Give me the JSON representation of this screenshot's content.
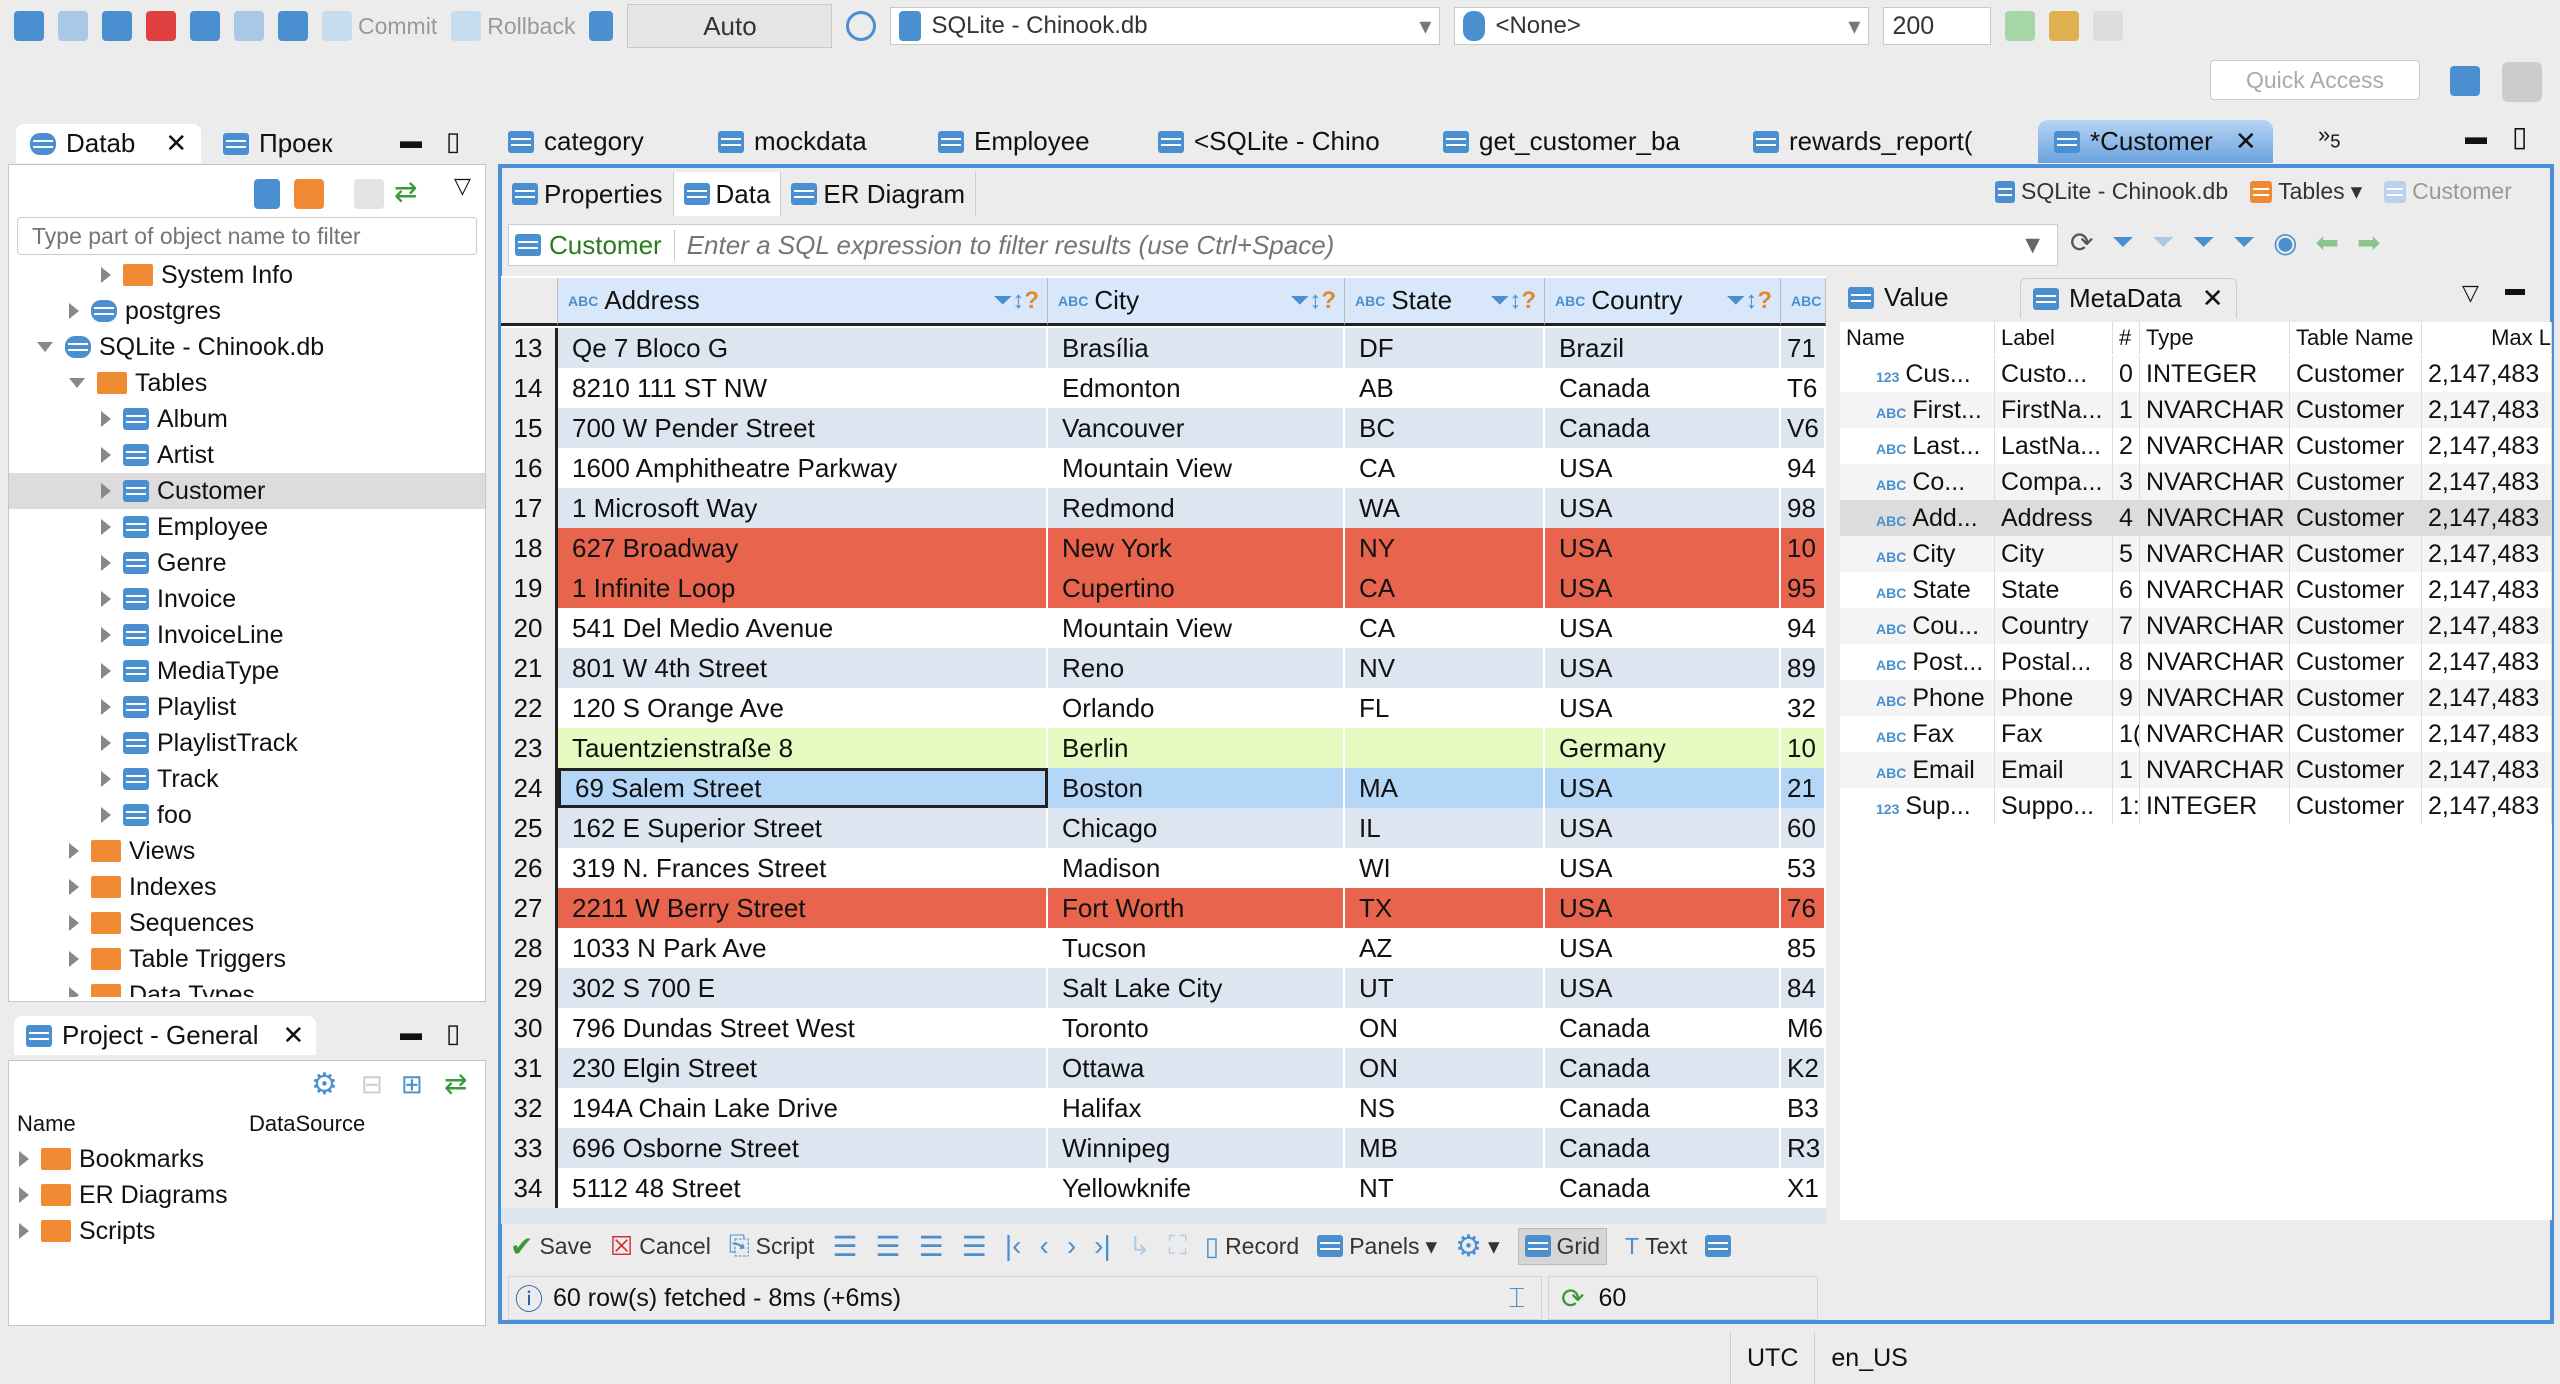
{
  "toolbar": {
    "commit": "Commit",
    "rollback": "Rollback",
    "mode": "Auto",
    "connection": "SQLite - Chinook.db",
    "schema": "<None>",
    "limit": "200",
    "quick_access": "Quick Access"
  },
  "left_tabs": {
    "database": "Datab",
    "project": "Проек"
  },
  "filter_placeholder": "Type part of object name to filter",
  "tree": [
    {
      "label": "System Info",
      "level": 2,
      "kind": "folder",
      "open": false
    },
    {
      "label": "postgres",
      "level": 1,
      "kind": "db",
      "open": false
    },
    {
      "label": "SQLite - Chinook.db",
      "level": 0,
      "kind": "db",
      "open": true
    },
    {
      "label": "Tables",
      "level": 1,
      "kind": "folder",
      "open": true
    },
    {
      "label": "Album",
      "level": 2,
      "kind": "table",
      "open": false
    },
    {
      "label": "Artist",
      "level": 2,
      "kind": "table",
      "open": false
    },
    {
      "label": "Customer",
      "level": 2,
      "kind": "table",
      "open": false,
      "selected": true
    },
    {
      "label": "Employee",
      "level": 2,
      "kind": "table",
      "open": false
    },
    {
      "label": "Genre",
      "level": 2,
      "kind": "table",
      "open": false
    },
    {
      "label": "Invoice",
      "level": 2,
      "kind": "table",
      "open": false
    },
    {
      "label": "InvoiceLine",
      "level": 2,
      "kind": "table",
      "open": false
    },
    {
      "label": "MediaType",
      "level": 2,
      "kind": "table",
      "open": false
    },
    {
      "label": "Playlist",
      "level": 2,
      "kind": "table",
      "open": false
    },
    {
      "label": "PlaylistTrack",
      "level": 2,
      "kind": "table",
      "open": false
    },
    {
      "label": "Track",
      "level": 2,
      "kind": "table",
      "open": false
    },
    {
      "label": "foo",
      "level": 2,
      "kind": "table",
      "open": false
    },
    {
      "label": "Views",
      "level": 1,
      "kind": "folder",
      "open": false
    },
    {
      "label": "Indexes",
      "level": 1,
      "kind": "folder",
      "open": false
    },
    {
      "label": "Sequences",
      "level": 1,
      "kind": "folder",
      "open": false
    },
    {
      "label": "Table Triggers",
      "level": 1,
      "kind": "folder",
      "open": false
    },
    {
      "label": "Data Types",
      "level": 1,
      "kind": "folder",
      "open": false
    }
  ],
  "project": {
    "title": "Project - General",
    "col_name": "Name",
    "col_datasource": "DataSource",
    "items": [
      "Bookmarks",
      "ER Diagrams",
      "Scripts"
    ]
  },
  "editor_tabs": [
    "category",
    "mockdata",
    "Employee",
    "<SQLite - Chino",
    "get_customer_ba",
    "rewards_report(",
    "*Customer"
  ],
  "overflow_count": "5",
  "sub_tabs": [
    "Properties",
    "Data",
    "ER Diagram"
  ],
  "breadcrumb": {
    "connection": "SQLite - Chinook.db",
    "folder": "Tables",
    "table": "Customer"
  },
  "filter": {
    "entity": "Customer",
    "placeholder": "Enter a SQL expression to filter results (use Ctrl+Space)"
  },
  "grid": {
    "columns": [
      "Address",
      "City",
      "State",
      "Country"
    ],
    "rows": [
      {
        "n": "13",
        "address": "Qe 7 Bloco G",
        "city": "Brasília",
        "state": "DF",
        "country": "Brazil",
        "postal": "71"
      },
      {
        "n": "14",
        "address": "8210 111 ST NW",
        "city": "Edmonton",
        "state": "AB",
        "country": "Canada",
        "postal": "T6"
      },
      {
        "n": "15",
        "address": "700 W Pender Street",
        "city": "Vancouver",
        "state": "BC",
        "country": "Canada",
        "postal": "V6"
      },
      {
        "n": "16",
        "address": "1600 Amphitheatre Parkway",
        "city": "Mountain View",
        "state": "CA",
        "country": "USA",
        "postal": "94"
      },
      {
        "n": "17",
        "address": "1 Microsoft Way",
        "city": "Redmond",
        "state": "WA",
        "country": "USA",
        "postal": "98"
      },
      {
        "n": "18",
        "address": "627 Broadway",
        "city": "New York",
        "state": "NY",
        "country": "USA",
        "postal": "10",
        "highlight": "red"
      },
      {
        "n": "19",
        "address": "1 Infinite Loop",
        "city": "Cupertino",
        "state": "CA",
        "country": "USA",
        "postal": "95",
        "highlight": "red"
      },
      {
        "n": "20",
        "address": "541 Del Medio Avenue",
        "city": "Mountain View",
        "state": "CA",
        "country": "USA",
        "postal": "94"
      },
      {
        "n": "21",
        "address": "801 W 4th Street",
        "city": "Reno",
        "state": "NV",
        "country": "USA",
        "postal": "89"
      },
      {
        "n": "22",
        "address": "120 S Orange Ave",
        "city": "Orlando",
        "state": "FL",
        "country": "USA",
        "postal": "32"
      },
      {
        "n": "23",
        "address": "Tauentzienstraße 8",
        "city": "Berlin",
        "state": "",
        "country": "Germany",
        "postal": "10",
        "highlight": "green"
      },
      {
        "n": "24",
        "address": "69 Salem Street",
        "city": "Boston",
        "state": "MA",
        "country": "USA",
        "postal": "21",
        "highlight": "selected"
      },
      {
        "n": "25",
        "address": "162 E Superior Street",
        "city": "Chicago",
        "state": "IL",
        "country": "USA",
        "postal": "60"
      },
      {
        "n": "26",
        "address": "319 N. Frances Street",
        "city": "Madison",
        "state": "WI",
        "country": "USA",
        "postal": "53"
      },
      {
        "n": "27",
        "address": "2211 W Berry Street",
        "city": "Fort Worth",
        "state": "TX",
        "country": "USA",
        "postal": "76",
        "highlight": "red"
      },
      {
        "n": "28",
        "address": "1033 N Park Ave",
        "city": "Tucson",
        "state": "AZ",
        "country": "USA",
        "postal": "85"
      },
      {
        "n": "29",
        "address": "302 S 700 E",
        "city": "Salt Lake City",
        "state": "UT",
        "country": "USA",
        "postal": "84"
      },
      {
        "n": "30",
        "address": "796 Dundas Street West",
        "city": "Toronto",
        "state": "ON",
        "country": "Canada",
        "postal": "M6"
      },
      {
        "n": "31",
        "address": "230 Elgin Street",
        "city": "Ottawa",
        "state": "ON",
        "country": "Canada",
        "postal": "K2"
      },
      {
        "n": "32",
        "address": "194A Chain Lake Drive",
        "city": "Halifax",
        "state": "NS",
        "country": "Canada",
        "postal": "B3"
      },
      {
        "n": "33",
        "address": "696 Osborne Street",
        "city": "Winnipeg",
        "state": "MB",
        "country": "Canada",
        "postal": "R3"
      },
      {
        "n": "34",
        "address": "5112 48 Street",
        "city": "Yellowknife",
        "state": "NT",
        "country": "Canada",
        "postal": "X1"
      }
    ]
  },
  "colors": {
    "red": "#e9644c",
    "green": "#e6fbc2",
    "selected": "#b5d7f7",
    "stripe": "#dde6f0",
    "accent": "#4a90d9"
  },
  "side_tabs": {
    "value": "Value",
    "metadata": "MetaData"
  },
  "metadata": {
    "columns": [
      "Name",
      "Label",
      "#",
      "Type",
      "Table Name",
      "Max L"
    ],
    "rows": [
      {
        "icon": "123",
        "name": "Cus...",
        "label": "Custo...",
        "idx": "0",
        "type": "INTEGER",
        "table": "Customer",
        "max": "2,147,483"
      },
      {
        "icon": "ABC",
        "name": "First...",
        "label": "FirstNa...",
        "idx": "1",
        "type": "NVARCHAR",
        "table": "Customer",
        "max": "2,147,483"
      },
      {
        "icon": "ABC",
        "name": "Last...",
        "label": "LastNa...",
        "idx": "2",
        "type": "NVARCHAR",
        "table": "Customer",
        "max": "2,147,483"
      },
      {
        "icon": "ABC",
        "name": "Co...",
        "label": "Compa...",
        "idx": "3",
        "type": "NVARCHAR",
        "table": "Customer",
        "max": "2,147,483"
      },
      {
        "icon": "ABC",
        "name": "Add...",
        "label": "Address",
        "idx": "4",
        "type": "NVARCHAR",
        "table": "Customer",
        "max": "2,147,483",
        "selected": true
      },
      {
        "icon": "ABC",
        "name": "City",
        "label": "City",
        "idx": "5",
        "type": "NVARCHAR",
        "table": "Customer",
        "max": "2,147,483"
      },
      {
        "icon": "ABC",
        "name": "State",
        "label": "State",
        "idx": "6",
        "type": "NVARCHAR",
        "table": "Customer",
        "max": "2,147,483"
      },
      {
        "icon": "ABC",
        "name": "Cou...",
        "label": "Country",
        "idx": "7",
        "type": "NVARCHAR",
        "table": "Customer",
        "max": "2,147,483"
      },
      {
        "icon": "ABC",
        "name": "Post...",
        "label": "Postal...",
        "idx": "8",
        "type": "NVARCHAR",
        "table": "Customer",
        "max": "2,147,483"
      },
      {
        "icon": "ABC",
        "name": "Phone",
        "label": "Phone",
        "idx": "9",
        "type": "NVARCHAR",
        "table": "Customer",
        "max": "2,147,483"
      },
      {
        "icon": "ABC",
        "name": "Fax",
        "label": "Fax",
        "idx": "1(",
        "type": "NVARCHAR",
        "table": "Customer",
        "max": "2,147,483"
      },
      {
        "icon": "ABC",
        "name": "Email",
        "label": "Email",
        "idx": "1",
        "type": "NVARCHAR",
        "table": "Customer",
        "max": "2,147,483"
      },
      {
        "icon": "123",
        "name": "Sup...",
        "label": "Suppo...",
        "idx": "1:",
        "type": "INTEGER",
        "table": "Customer",
        "max": "2,147,483"
      }
    ]
  },
  "bottom_toolbar": {
    "save": "Save",
    "cancel": "Cancel",
    "script": "Script",
    "record": "Record",
    "panels": "Panels",
    "grid": "Grid",
    "text": "Text"
  },
  "status": {
    "message": "60 row(s) fetched - 8ms (+6ms)",
    "count": "60"
  },
  "statusbar": {
    "timezone": "UTC",
    "locale": "en_US"
  }
}
